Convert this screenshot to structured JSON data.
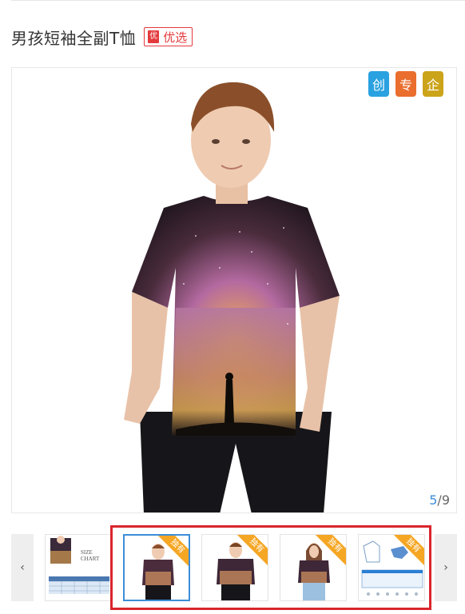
{
  "product": {
    "title": "男孩短袖全副T恤",
    "badge_icon_text": "优",
    "badge_label": "优选"
  },
  "main_image": {
    "tags": [
      "创",
      "专",
      "企"
    ],
    "current_index": "5",
    "separator": "/",
    "total": "9"
  },
  "thumbnails": {
    "prev_label": "‹",
    "next_label": "›",
    "items": [
      {
        "caption": "SIZE CHART",
        "ribbon": ""
      },
      {
        "caption": "",
        "ribbon": "独有"
      },
      {
        "caption": "",
        "ribbon": "独有"
      },
      {
        "caption": "",
        "ribbon": "独有"
      },
      {
        "caption": "",
        "ribbon": "独有"
      }
    ]
  },
  "colors": {
    "accent_blue": "#3c8ed8",
    "badge_red": "#e4393c",
    "highlight_red": "#d9262c",
    "ribbon_orange": "#f5a623"
  }
}
